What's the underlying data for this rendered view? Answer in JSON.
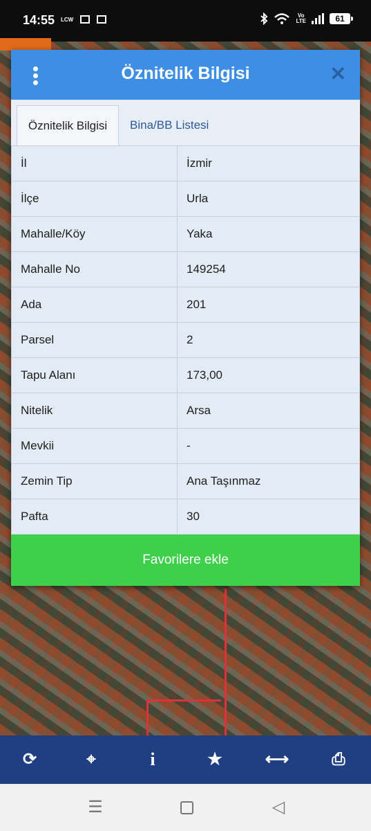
{
  "status_bar": {
    "time": "14:55",
    "carrier_mini": "LCW",
    "volte": "Vo\nLTE",
    "battery": "61"
  },
  "dialog": {
    "title": "Öznitelik Bilgisi",
    "tabs": [
      {
        "label": "Öznitelik Bilgisi",
        "active": true
      },
      {
        "label": "Bina/BB Listesi",
        "active": false
      }
    ],
    "rows": [
      {
        "key": "İl",
        "value": "İzmir"
      },
      {
        "key": "İlçe",
        "value": "Urla"
      },
      {
        "key": "Mahalle/Köy",
        "value": "Yaka"
      },
      {
        "key": "Mahalle No",
        "value": "149254"
      },
      {
        "key": "Ada",
        "value": "201"
      },
      {
        "key": "Parsel",
        "value": "2"
      },
      {
        "key": "Tapu Alanı",
        "value": "173,00"
      },
      {
        "key": "Nitelik",
        "value": "Arsa"
      },
      {
        "key": "Mevkii",
        "value": "-"
      },
      {
        "key": "Zemin Tip",
        "value": "Ana Taşınmaz"
      },
      {
        "key": "Pafta",
        "value": "30"
      }
    ],
    "favorite_button": "Favorilere ekle"
  },
  "toolbar": {
    "refresh": "⟳",
    "locate": "⌖",
    "info": "i",
    "favorite": "★",
    "measure": "⟷",
    "print": "⎙"
  },
  "navigation": {
    "menu": "☰",
    "back": "◁"
  },
  "colors": {
    "header": "#3e8ee5",
    "favorite_button": "#3ed04b",
    "toolbar": "#1f3f82"
  }
}
